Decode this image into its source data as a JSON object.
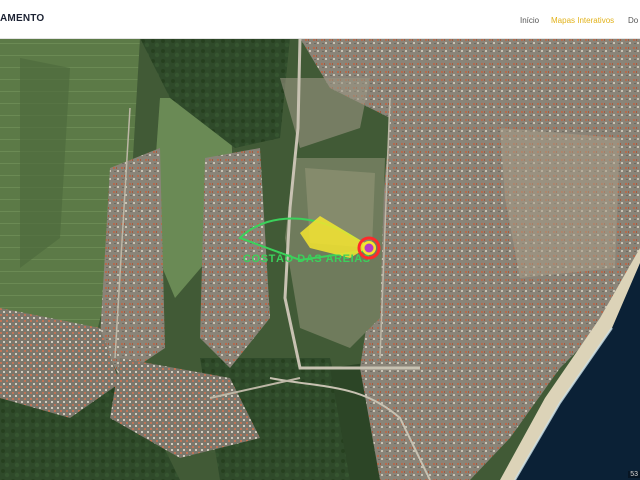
{
  "header": {
    "brand": "AMENTO",
    "nav": [
      {
        "label": "Início",
        "active": false
      },
      {
        "label": "Mapas Interativos",
        "active": true
      },
      {
        "label": "Do",
        "active": false
      }
    ]
  },
  "map": {
    "overlay_label": "COSTÃO DAS AREIAS",
    "marker_icon": "location-pin-icon",
    "coord_readout": "53",
    "colors": {
      "accent": "#e2b21a",
      "highlight": "#f5e52f",
      "label": "#3bd15b",
      "ocean": "#0b2136",
      "marker_ring": "#ff2a2a",
      "marker_center": "#b43cc7"
    }
  }
}
